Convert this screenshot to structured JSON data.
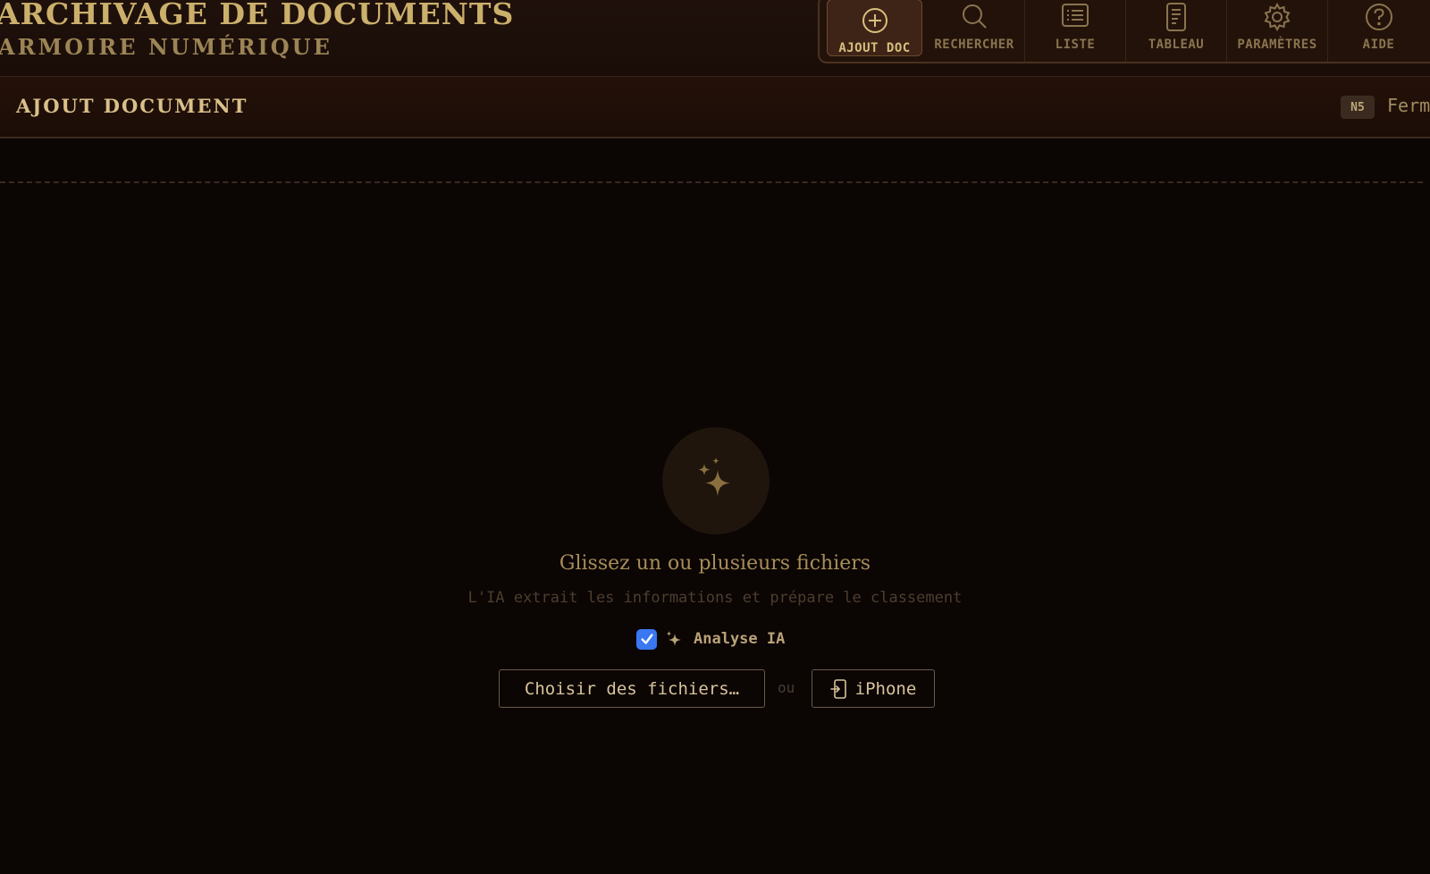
{
  "header": {
    "title": "ARCHIVAGE DE DOCUMENTS",
    "subtitle": "ARMOIRE NUMÉRIQUE"
  },
  "toolbar": {
    "items": [
      {
        "label": "AJOUT DOC",
        "icon": "add-circle-icon",
        "active": true
      },
      {
        "label": "RECHERCHER",
        "icon": "search-icon",
        "active": false
      },
      {
        "label": "LISTE",
        "icon": "list-icon",
        "active": false
      },
      {
        "label": "TABLEAU",
        "icon": "dashboard-icon",
        "active": false
      },
      {
        "label": "PARAMÈTRES",
        "icon": "gear-icon",
        "active": false
      },
      {
        "label": "AIDE",
        "icon": "help-icon",
        "active": false
      }
    ]
  },
  "panel": {
    "title": "AJOUT DOCUMENT",
    "shortcut": "N5",
    "close_label": "Ferm"
  },
  "dropzone": {
    "icon": "sparkles-icon",
    "title": "Glissez un ou plusieurs fichiers",
    "subtitle": "L'IA extrait les informations et prépare le classement",
    "ai_toggle": {
      "label": "Analyse IA",
      "checked": true
    },
    "choose_files_label": "Choisir des fichiers…",
    "or_label": "ou",
    "iphone_label": "iPhone"
  },
  "colors": {
    "background": "#0b0504",
    "accent_gold": "#cbb06c",
    "checkbox_blue": "#3a78f2"
  }
}
